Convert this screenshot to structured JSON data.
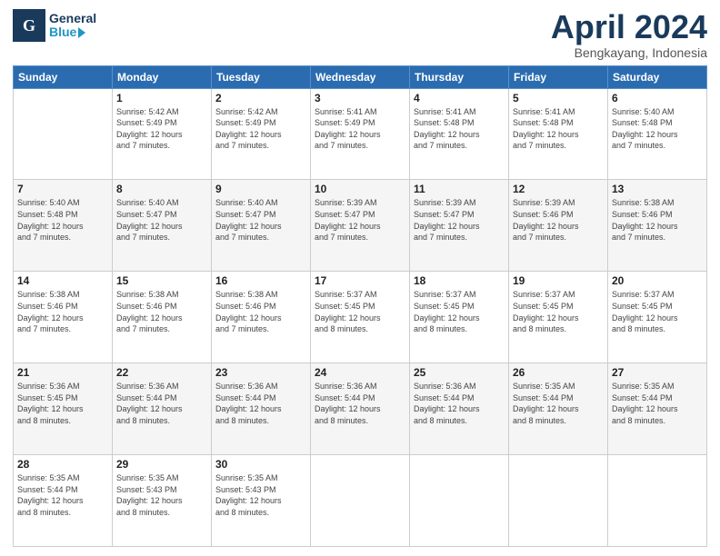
{
  "header": {
    "logo_top": "General",
    "logo_bot": "Blue",
    "title": "April 2024",
    "subtitle": "Bengkayang, Indonesia"
  },
  "days_of_week": [
    "Sunday",
    "Monday",
    "Tuesday",
    "Wednesday",
    "Thursday",
    "Friday",
    "Saturday"
  ],
  "weeks": [
    [
      {
        "day": "",
        "info": ""
      },
      {
        "day": "1",
        "info": "Sunrise: 5:42 AM\nSunset: 5:49 PM\nDaylight: 12 hours\nand 7 minutes."
      },
      {
        "day": "2",
        "info": "Sunrise: 5:42 AM\nSunset: 5:49 PM\nDaylight: 12 hours\nand 7 minutes."
      },
      {
        "day": "3",
        "info": "Sunrise: 5:41 AM\nSunset: 5:49 PM\nDaylight: 12 hours\nand 7 minutes."
      },
      {
        "day": "4",
        "info": "Sunrise: 5:41 AM\nSunset: 5:48 PM\nDaylight: 12 hours\nand 7 minutes."
      },
      {
        "day": "5",
        "info": "Sunrise: 5:41 AM\nSunset: 5:48 PM\nDaylight: 12 hours\nand 7 minutes."
      },
      {
        "day": "6",
        "info": "Sunrise: 5:40 AM\nSunset: 5:48 PM\nDaylight: 12 hours\nand 7 minutes."
      }
    ],
    [
      {
        "day": "7",
        "info": "Sunrise: 5:40 AM\nSunset: 5:48 PM\nDaylight: 12 hours\nand 7 minutes."
      },
      {
        "day": "8",
        "info": "Sunrise: 5:40 AM\nSunset: 5:47 PM\nDaylight: 12 hours\nand 7 minutes."
      },
      {
        "day": "9",
        "info": "Sunrise: 5:40 AM\nSunset: 5:47 PM\nDaylight: 12 hours\nand 7 minutes."
      },
      {
        "day": "10",
        "info": "Sunrise: 5:39 AM\nSunset: 5:47 PM\nDaylight: 12 hours\nand 7 minutes."
      },
      {
        "day": "11",
        "info": "Sunrise: 5:39 AM\nSunset: 5:47 PM\nDaylight: 12 hours\nand 7 minutes."
      },
      {
        "day": "12",
        "info": "Sunrise: 5:39 AM\nSunset: 5:46 PM\nDaylight: 12 hours\nand 7 minutes."
      },
      {
        "day": "13",
        "info": "Sunrise: 5:38 AM\nSunset: 5:46 PM\nDaylight: 12 hours\nand 7 minutes."
      }
    ],
    [
      {
        "day": "14",
        "info": "Sunrise: 5:38 AM\nSunset: 5:46 PM\nDaylight: 12 hours\nand 7 minutes."
      },
      {
        "day": "15",
        "info": "Sunrise: 5:38 AM\nSunset: 5:46 PM\nDaylight: 12 hours\nand 7 minutes."
      },
      {
        "day": "16",
        "info": "Sunrise: 5:38 AM\nSunset: 5:46 PM\nDaylight: 12 hours\nand 7 minutes."
      },
      {
        "day": "17",
        "info": "Sunrise: 5:37 AM\nSunset: 5:45 PM\nDaylight: 12 hours\nand 8 minutes."
      },
      {
        "day": "18",
        "info": "Sunrise: 5:37 AM\nSunset: 5:45 PM\nDaylight: 12 hours\nand 8 minutes."
      },
      {
        "day": "19",
        "info": "Sunrise: 5:37 AM\nSunset: 5:45 PM\nDaylight: 12 hours\nand 8 minutes."
      },
      {
        "day": "20",
        "info": "Sunrise: 5:37 AM\nSunset: 5:45 PM\nDaylight: 12 hours\nand 8 minutes."
      }
    ],
    [
      {
        "day": "21",
        "info": "Sunrise: 5:36 AM\nSunset: 5:45 PM\nDaylight: 12 hours\nand 8 minutes."
      },
      {
        "day": "22",
        "info": "Sunrise: 5:36 AM\nSunset: 5:44 PM\nDaylight: 12 hours\nand 8 minutes."
      },
      {
        "day": "23",
        "info": "Sunrise: 5:36 AM\nSunset: 5:44 PM\nDaylight: 12 hours\nand 8 minutes."
      },
      {
        "day": "24",
        "info": "Sunrise: 5:36 AM\nSunset: 5:44 PM\nDaylight: 12 hours\nand 8 minutes."
      },
      {
        "day": "25",
        "info": "Sunrise: 5:36 AM\nSunset: 5:44 PM\nDaylight: 12 hours\nand 8 minutes."
      },
      {
        "day": "26",
        "info": "Sunrise: 5:35 AM\nSunset: 5:44 PM\nDaylight: 12 hours\nand 8 minutes."
      },
      {
        "day": "27",
        "info": "Sunrise: 5:35 AM\nSunset: 5:44 PM\nDaylight: 12 hours\nand 8 minutes."
      }
    ],
    [
      {
        "day": "28",
        "info": "Sunrise: 5:35 AM\nSunset: 5:44 PM\nDaylight: 12 hours\nand 8 minutes."
      },
      {
        "day": "29",
        "info": "Sunrise: 5:35 AM\nSunset: 5:43 PM\nDaylight: 12 hours\nand 8 minutes."
      },
      {
        "day": "30",
        "info": "Sunrise: 5:35 AM\nSunset: 5:43 PM\nDaylight: 12 hours\nand 8 minutes."
      },
      {
        "day": "",
        "info": ""
      },
      {
        "day": "",
        "info": ""
      },
      {
        "day": "",
        "info": ""
      },
      {
        "day": "",
        "info": ""
      }
    ]
  ]
}
